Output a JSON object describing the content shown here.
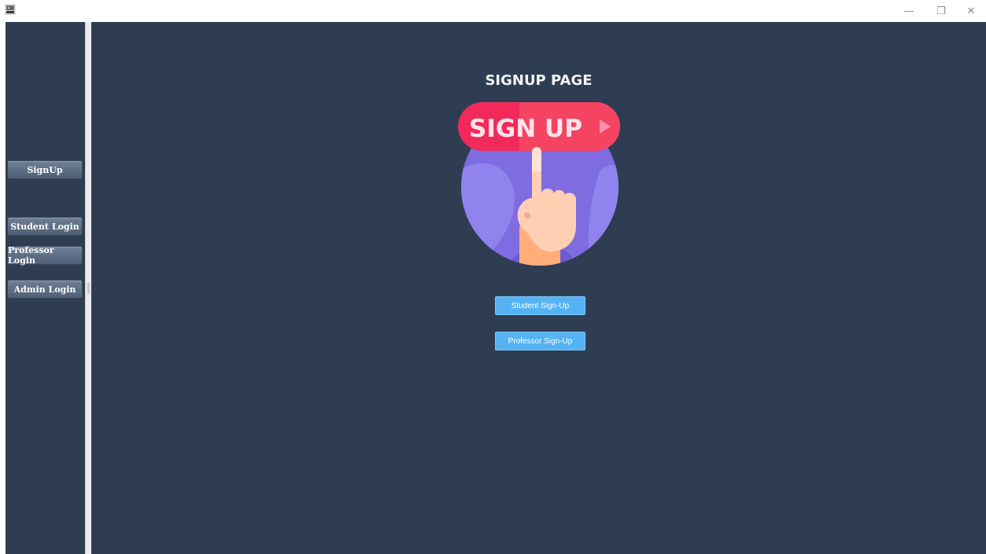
{
  "window": {
    "minimize_glyph": "—",
    "restore_glyph": "❐",
    "close_glyph": "✕"
  },
  "sidebar": {
    "items": [
      {
        "label": "SignUp"
      },
      {
        "label": "Student Login"
      },
      {
        "label": "Professor Login"
      },
      {
        "label": "Admin Login"
      }
    ]
  },
  "main": {
    "title": "SIGNUP PAGE",
    "illustration": {
      "banner_text": "SIGN UP",
      "icon": "pointing-hand-icon"
    },
    "buttons": [
      {
        "label": "Student Sign-Up"
      },
      {
        "label": "Professor Sign-Up"
      }
    ]
  },
  "colors": {
    "background": "#2e3d51",
    "sidebar_button": "#5d6e84",
    "action_button": "#55b3f3",
    "banner": "#f2295b",
    "circle": "#7e6ce0"
  }
}
